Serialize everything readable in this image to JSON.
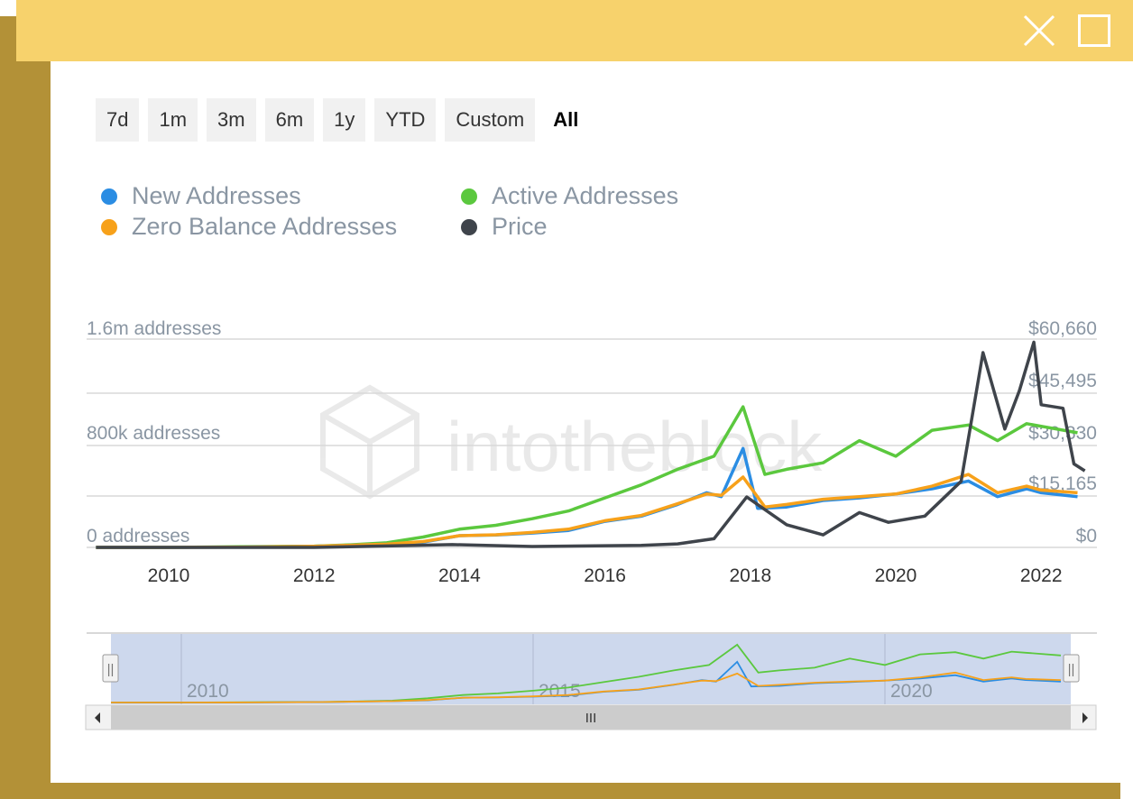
{
  "window": {
    "close_icon": "close-icon",
    "maximize_icon": "maximize-icon"
  },
  "ranges": [
    "7d",
    "1m",
    "3m",
    "6m",
    "1y",
    "YTD",
    "Custom",
    "All"
  ],
  "active_range": "All",
  "watermark": "intotheblock",
  "colors": {
    "new": "#2b8de3",
    "active": "#5bc83e",
    "zero": "#f7a11a",
    "price": "#3f444b",
    "frame": "#b39137",
    "titlebar": "#f7d26c"
  },
  "chart_data": {
    "type": "line",
    "title": "",
    "xlabel": "",
    "ylabel_left": "",
    "ylabel_right": "",
    "x_ticks": [
      "2010",
      "2012",
      "2014",
      "2016",
      "2018",
      "2020",
      "2022"
    ],
    "y_left_ticks": [
      "1.6m addresses",
      "800k addresses",
      "0 addresses"
    ],
    "y_right_ticks": [
      "$60,660",
      "$45,495",
      "$30,330",
      "$15,165",
      "$0"
    ],
    "ylim_left": [
      0,
      1600000
    ],
    "ylim_right": [
      0,
      60660
    ],
    "legend_position": "top",
    "grid": true,
    "series": [
      {
        "name": "New Addresses",
        "axis": "left",
        "color": "#2b8de3",
        "points": [
          [
            2009.0,
            0
          ],
          [
            2010.0,
            0
          ],
          [
            2011.0,
            2000
          ],
          [
            2012.0,
            8000
          ],
          [
            2013.0,
            25000
          ],
          [
            2013.5,
            40000
          ],
          [
            2014.0,
            90000
          ],
          [
            2014.5,
            95000
          ],
          [
            2015.0,
            110000
          ],
          [
            2015.5,
            130000
          ],
          [
            2016.0,
            200000
          ],
          [
            2016.5,
            240000
          ],
          [
            2017.0,
            330000
          ],
          [
            2017.4,
            420000
          ],
          [
            2017.6,
            390000
          ],
          [
            2017.9,
            760000
          ],
          [
            2018.1,
            300000
          ],
          [
            2018.5,
            310000
          ],
          [
            2019.0,
            360000
          ],
          [
            2019.5,
            380000
          ],
          [
            2020.0,
            410000
          ],
          [
            2020.5,
            450000
          ],
          [
            2021.0,
            510000
          ],
          [
            2021.4,
            390000
          ],
          [
            2021.8,
            450000
          ],
          [
            2022.0,
            420000
          ],
          [
            2022.5,
            390000
          ]
        ]
      },
      {
        "name": "Zero Balance Addresses",
        "axis": "left",
        "color": "#f7a11a",
        "points": [
          [
            2009.0,
            0
          ],
          [
            2010.0,
            0
          ],
          [
            2011.0,
            2000
          ],
          [
            2012.0,
            8000
          ],
          [
            2013.0,
            25000
          ],
          [
            2013.5,
            45000
          ],
          [
            2014.0,
            90000
          ],
          [
            2014.5,
            97000
          ],
          [
            2015.0,
            115000
          ],
          [
            2015.5,
            140000
          ],
          [
            2016.0,
            205000
          ],
          [
            2016.5,
            245000
          ],
          [
            2017.0,
            335000
          ],
          [
            2017.4,
            410000
          ],
          [
            2017.6,
            400000
          ],
          [
            2017.9,
            540000
          ],
          [
            2018.2,
            310000
          ],
          [
            2018.5,
            330000
          ],
          [
            2019.0,
            370000
          ],
          [
            2019.5,
            390000
          ],
          [
            2020.0,
            410000
          ],
          [
            2020.5,
            470000
          ],
          [
            2021.0,
            560000
          ],
          [
            2021.4,
            420000
          ],
          [
            2021.8,
            470000
          ],
          [
            2022.0,
            440000
          ],
          [
            2022.5,
            420000
          ]
        ]
      },
      {
        "name": "Active Addresses",
        "axis": "left",
        "color": "#5bc83e",
        "points": [
          [
            2009.0,
            0
          ],
          [
            2010.0,
            0
          ],
          [
            2011.0,
            5000
          ],
          [
            2012.0,
            10000
          ],
          [
            2012.5,
            20000
          ],
          [
            2013.0,
            35000
          ],
          [
            2013.5,
            80000
          ],
          [
            2014.0,
            140000
          ],
          [
            2014.5,
            170000
          ],
          [
            2015.0,
            220000
          ],
          [
            2015.5,
            280000
          ],
          [
            2016.0,
            380000
          ],
          [
            2016.5,
            480000
          ],
          [
            2017.0,
            600000
          ],
          [
            2017.5,
            700000
          ],
          [
            2017.9,
            1080000
          ],
          [
            2018.2,
            560000
          ],
          [
            2018.5,
            600000
          ],
          [
            2019.0,
            650000
          ],
          [
            2019.5,
            820000
          ],
          [
            2020.0,
            700000
          ],
          [
            2020.5,
            900000
          ],
          [
            2021.0,
            940000
          ],
          [
            2021.4,
            820000
          ],
          [
            2021.8,
            950000
          ],
          [
            2022.0,
            930000
          ],
          [
            2022.5,
            880000
          ]
        ]
      },
      {
        "name": "Price",
        "axis": "right",
        "color": "#3f444b",
        "points": [
          [
            2009.0,
            0
          ],
          [
            2010.5,
            0
          ],
          [
            2012.0,
            10
          ],
          [
            2013.9,
            800
          ],
          [
            2015.0,
            250
          ],
          [
            2016.5,
            600
          ],
          [
            2017.0,
            1000
          ],
          [
            2017.5,
            2500
          ],
          [
            2017.95,
            14500
          ],
          [
            2018.5,
            6500
          ],
          [
            2019.0,
            3600
          ],
          [
            2019.5,
            10000
          ],
          [
            2019.9,
            7200
          ],
          [
            2020.4,
            9000
          ],
          [
            2020.9,
            19000
          ],
          [
            2021.2,
            56000
          ],
          [
            2021.5,
            34000
          ],
          [
            2021.7,
            45000
          ],
          [
            2021.9,
            59000
          ],
          [
            2022.0,
            41000
          ],
          [
            2022.3,
            40000
          ],
          [
            2022.45,
            24000
          ],
          [
            2022.6,
            22000
          ]
        ]
      }
    ]
  },
  "navigator": {
    "labels": [
      "2010",
      "2015",
      "2020"
    ],
    "scroll_grip": "III",
    "left_handle_grip": "||",
    "right_handle_grip": "||"
  }
}
